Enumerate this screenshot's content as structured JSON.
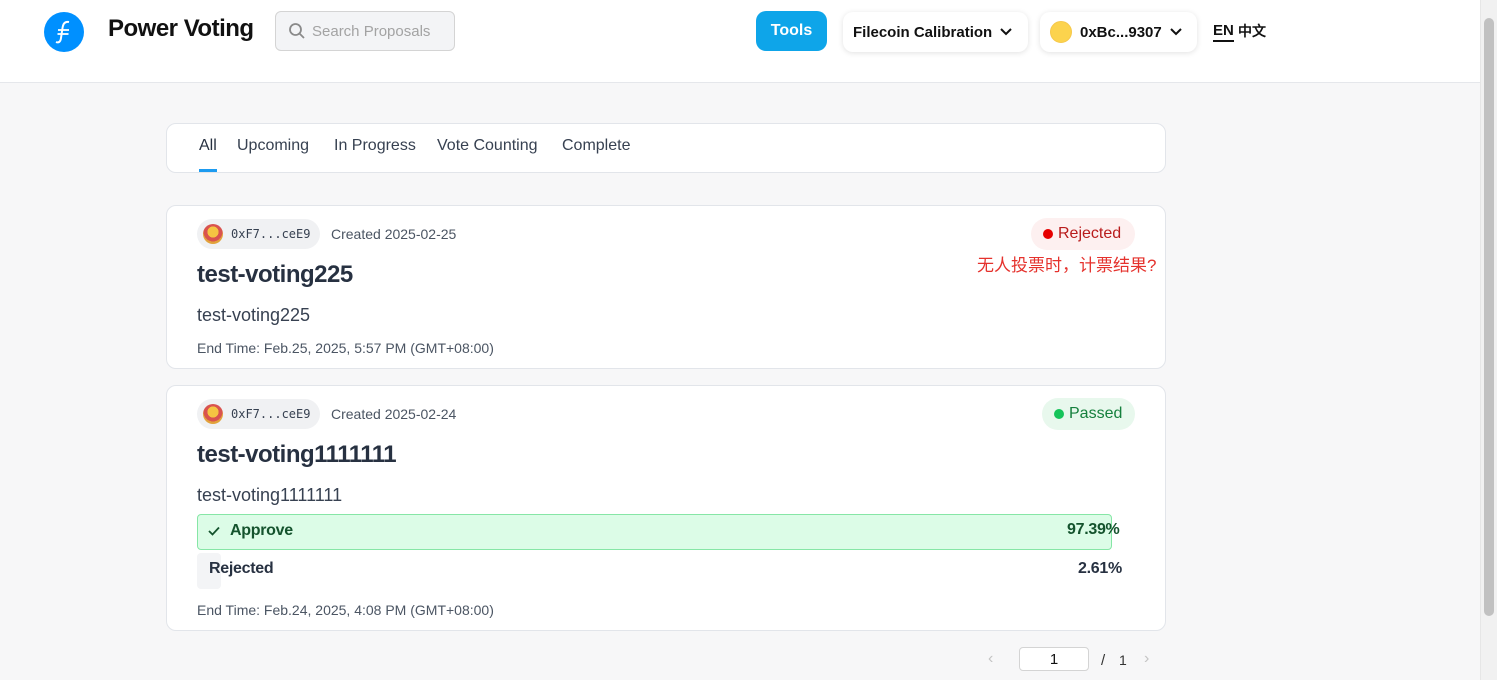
{
  "app": {
    "brand": "Power Voting",
    "search_placeholder": "Search Proposals",
    "tools_label": "Tools",
    "network": "Filecoin Calibration",
    "wallet": "0xBc...9307",
    "lang_en": "EN",
    "lang_zh": "中文"
  },
  "tabs": [
    {
      "label": "All",
      "active": true
    },
    {
      "label": "Upcoming",
      "active": false
    },
    {
      "label": "In Progress",
      "active": false
    },
    {
      "label": "Vote Counting",
      "active": false
    },
    {
      "label": "Complete",
      "active": false
    }
  ],
  "proposals": [
    {
      "author": "0xF7...ceE9",
      "created": "Created 2025-02-25",
      "status": "Rejected",
      "title": "test-voting225",
      "description": "test-voting225",
      "end_time_label": "End Time:",
      "end_time": "Feb.25, 2025, 5:57 PM (GMT+08:00)",
      "annotation": "无人投票时，计票结果?"
    },
    {
      "author": "0xF7...ceE9",
      "created": "Created 2025-02-24",
      "status": "Passed",
      "title": "test-voting1111111",
      "description": "test-voting1111111",
      "votes": [
        {
          "option": "Approve",
          "percent": "97.39%",
          "share": 0.9739,
          "selected": true
        },
        {
          "option": "Rejected",
          "percent": "2.61%",
          "share": 0.0261,
          "selected": false
        }
      ],
      "end_time_label": "End Time:",
      "end_time": "Feb.24, 2025, 4:08 PM (GMT+08:00)"
    }
  ],
  "pagination": {
    "current": "1",
    "separator": "/",
    "total": "1"
  },
  "colors": {
    "accent": "#0ea5e9",
    "tab_underline": "#1d9bf0",
    "rejected": "#e60000",
    "passed": "#16c45a",
    "approve_bg": "#dcfce7",
    "annotation": "#e5322d"
  }
}
